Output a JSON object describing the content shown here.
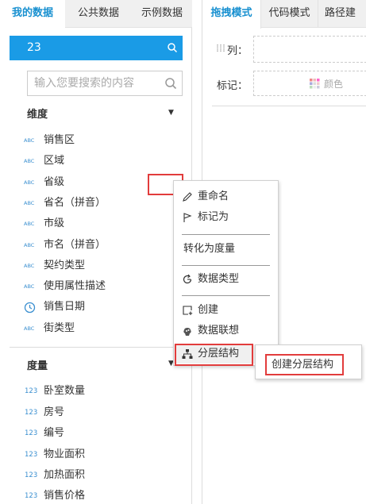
{
  "left_tabs": [
    "我的数据",
    "公共数据",
    "示例数据"
  ],
  "dataset": {
    "value": "23",
    "icon": "search-icon"
  },
  "search": {
    "placeholder": "输入您要搜索的内容",
    "icon": "search-icon"
  },
  "dimensions": {
    "title": "维度",
    "caret": "▼",
    "items": [
      {
        "type": "ABC",
        "label": "销售区"
      },
      {
        "type": "ABC",
        "label": "区域"
      },
      {
        "type": "ABC",
        "label": "省级"
      },
      {
        "type": "ABC",
        "label": "省名（拼音）"
      },
      {
        "type": "ABC",
        "label": "市级"
      },
      {
        "type": "ABC",
        "label": "市名（拼音）"
      },
      {
        "type": "ABC",
        "label": "契约类型"
      },
      {
        "type": "ABC",
        "label": "使用属性描述"
      },
      {
        "type": "clock-icon",
        "label": "销售日期"
      },
      {
        "type": "ABC",
        "label": "街类型"
      }
    ]
  },
  "measures": {
    "title": "度量",
    "caret": "▼",
    "items": [
      {
        "type": "123",
        "label": "卧室数量"
      },
      {
        "type": "123",
        "label": "房号"
      },
      {
        "type": "123",
        "label": "编号"
      },
      {
        "type": "123",
        "label": "物业面积"
      },
      {
        "type": "123",
        "label": "加热面积"
      },
      {
        "type": "123",
        "label": "销售价格"
      }
    ]
  },
  "right_tabs": [
    "拖拽模式",
    "代码模式",
    "路径建"
  ],
  "shelves": {
    "columns_label": "列：",
    "mark_label": "标记：",
    "color_label": "颜色"
  },
  "context_menu": {
    "items": [
      {
        "icon": "pencil-icon",
        "label": "重命名"
      },
      {
        "icon": "flag-icon",
        "label": "标记为"
      },
      {
        "icon": "",
        "label": "转化为度量"
      },
      {
        "icon": "refresh-icon",
        "label": "数据类型"
      },
      {
        "icon": "add-icon",
        "label": "创建"
      },
      {
        "icon": "brain-icon",
        "label": "数据联想"
      },
      {
        "icon": "hierarchy-icon",
        "label": "分层结构"
      }
    ]
  },
  "submenu": {
    "label": "创建分层结构"
  },
  "colors": {
    "accent": "#1a9be6",
    "highlight": "#e23c3c"
  }
}
